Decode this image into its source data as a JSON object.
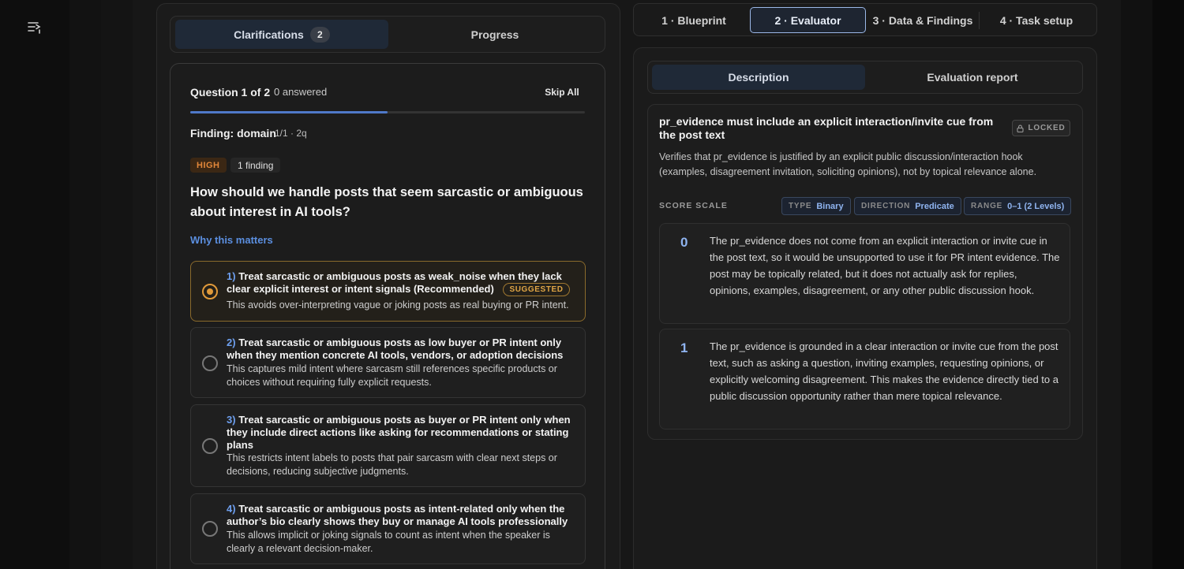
{
  "left_tabs": {
    "clarifications_label": "Clarifications",
    "clarifications_count": "2",
    "progress_label": "Progress"
  },
  "question_card": {
    "header": "Question 1 of 2",
    "answered": "0 answered",
    "skip_all": "Skip All",
    "progress_fraction": 0.5,
    "finding_label": "Finding: domain",
    "finding_meta": "1/1 · 2q",
    "severity": "HIGH",
    "finding_count": "1 finding",
    "question": "How should we handle posts that seem sarcastic or ambiguous about interest in AI tools?",
    "why_link": "Why this matters",
    "options": [
      {
        "num": "1)",
        "title": "Treat sarcastic or ambiguous posts as weak_noise when they lack clear explicit interest or intent signals (Recommended)",
        "badge": "SUGGESTED",
        "desc": "This avoids over-interpreting vague or joking posts as real buying or PR intent."
      },
      {
        "num": "2)",
        "title": "Treat sarcastic or ambiguous posts as low buyer or PR intent only when they mention concrete AI tools, vendors, or adoption decisions",
        "desc": "This captures mild intent where sarcasm still references specific products or choices without requiring fully explicit requests."
      },
      {
        "num": "3)",
        "title": "Treat sarcastic or ambiguous posts as buyer or PR intent only when they include direct actions like asking for recommendations or stating plans",
        "desc": "This restricts intent labels to posts that pair sarcasm with clear next steps or decisions, reducing subjective judgments."
      },
      {
        "num": "4)",
        "title": "Treat sarcastic or ambiguous posts as intent-related only when the author’s bio clearly shows they buy or manage AI tools professionally",
        "desc": "This allows implicit or joking signals to count as intent when the speaker is clearly a relevant decision-maker."
      }
    ]
  },
  "top_tabs": [
    "1 · Blueprint",
    "2 · Evaluator",
    "3 · Data & Findings",
    "4 · Task setup"
  ],
  "eval_tabs": {
    "description": "Description",
    "report": "Evaluation report"
  },
  "evaluator": {
    "title": "pr_evidence must include an explicit interaction/invite cue from the post text",
    "locked": "LOCKED",
    "description": "Verifies that pr_evidence is justified by an explicit public discussion/interaction hook (examples, disagreement invitation, soliciting opinions), not by topical relevance alone.",
    "scale_label": "SCORE SCALE",
    "type_key": "TYPE",
    "type_val": "Binary",
    "direction_key": "DIRECTION",
    "direction_val": "Predicate",
    "range_key": "RANGE",
    "range_val": "0–1 (2 Levels)",
    "levels": [
      {
        "score": "0",
        "text": "The pr_evidence does not come from an explicit interaction or invite cue in the post text, so it would be unsupported to use it for PR intent evidence. The post may be topically related, but it does not actually ask for replies, opinions, examples, disagreement, or any other public discussion hook."
      },
      {
        "score": "1",
        "text": "The pr_evidence is grounded in a clear interaction or invite cue from the post text, such as asking a question, inviting examples, requesting opinions, or explicitly welcoming disagreement. This makes the evidence directly tied to a public discussion opportunity rather than mere topical relevance."
      }
    ]
  },
  "colors": {
    "accent_blue": "#4f79c9",
    "suggested_orange": "#e09a3a",
    "high_orange": "#e2873a"
  },
  "icons": {
    "sidebar_toggle": "sidebar-list-icon",
    "lock": "lock-icon"
  }
}
